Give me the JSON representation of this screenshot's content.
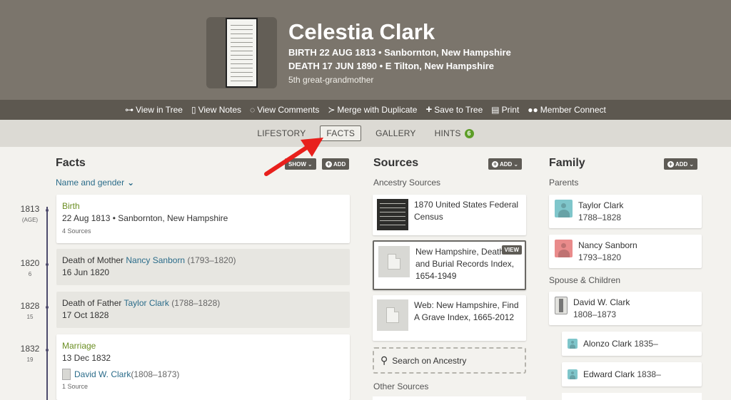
{
  "person": {
    "name": "Celestia Clark",
    "birth": "BIRTH  22 AUG 1813 • Sanbornton, New Hampshire",
    "death": "DEATH  17 JUN 1890 • E Tilton, New Hampshire",
    "relation": "5th great-grandmother"
  },
  "actions": [
    {
      "label": "View in Tree",
      "icon": "tree-icon"
    },
    {
      "label": "View Notes",
      "icon": "notes-icon"
    },
    {
      "label": "View Comments",
      "icon": "comments-icon"
    },
    {
      "label": "Merge with Duplicate",
      "icon": "merge-icon"
    },
    {
      "label": "Save to Tree",
      "icon": "plus-icon"
    },
    {
      "label": "Print",
      "icon": "print-icon"
    },
    {
      "label": "Member Connect",
      "icon": "members-icon"
    }
  ],
  "tabs": [
    {
      "label": "LIFESTORY"
    },
    {
      "label": "FACTS",
      "active": true
    },
    {
      "label": "GALLERY"
    },
    {
      "label": "HINTS",
      "badge": "6"
    }
  ],
  "facts": {
    "title": "Facts",
    "show_label": "SHOW",
    "add_label": "ADD",
    "filter": "Name and gender",
    "items": [
      {
        "year": "1813",
        "age": "(AGE)",
        "title": "Birth",
        "detail": "22 Aug 1813 • Sanbornton, New Hampshire",
        "sources": "4 Sources"
      },
      {
        "year": "1820",
        "age": "6",
        "prefix": "Death of Mother ",
        "link": "Nancy Sanborn",
        "dates": " (1793–1820)",
        "detail": "16 Jun 1820"
      },
      {
        "year": "1828",
        "age": "15",
        "prefix": "Death of Father ",
        "link": "Taylor Clark",
        "dates": " (1788–1828)",
        "detail": "17 Oct 1828"
      },
      {
        "year": "1832",
        "age": "19",
        "title": "Marriage",
        "detail": "13 Dec 1832",
        "spouse": "David W. Clark",
        "spouse_dates": " (1808–1873)",
        "sources": "1 Source"
      }
    ]
  },
  "sources": {
    "title": "Sources",
    "add_label": "ADD",
    "ancestry_label": "Ancestry Sources",
    "items": [
      {
        "title": "1870 United States Federal Census"
      },
      {
        "title": "New Hampshire, Death and Burial Records Index, 1654-1949",
        "view": "VIEW"
      },
      {
        "title": "Web: New Hampshire, Find A Grave Index, 1665-2012"
      }
    ],
    "search_label": "Search on Ancestry",
    "other_label": "Other Sources"
  },
  "family": {
    "title": "Family",
    "add_label": "ADD",
    "parents_label": "Parents",
    "parents": [
      {
        "name": "Taylor Clark",
        "dates": "1788–1828"
      },
      {
        "name": "Nancy Sanborn",
        "dates": "1793–1820"
      }
    ],
    "spouse_label": "Spouse & Children",
    "spouse": {
      "name": "David W. Clark",
      "dates": "1808–1873"
    },
    "children": [
      {
        "name": "Alonzo Clark",
        "dates": "1835–"
      },
      {
        "name": "Edward Clark",
        "dates": "1838–"
      }
    ]
  },
  "colors": {
    "header": "#7b756c",
    "action_bar": "#5d5850",
    "tab_bar": "#dcdad4",
    "link": "#2b6c8a",
    "fact_green": "#6b8e23",
    "hint_badge": "#5d9e28",
    "annotation_arrow": "#e8201c"
  }
}
